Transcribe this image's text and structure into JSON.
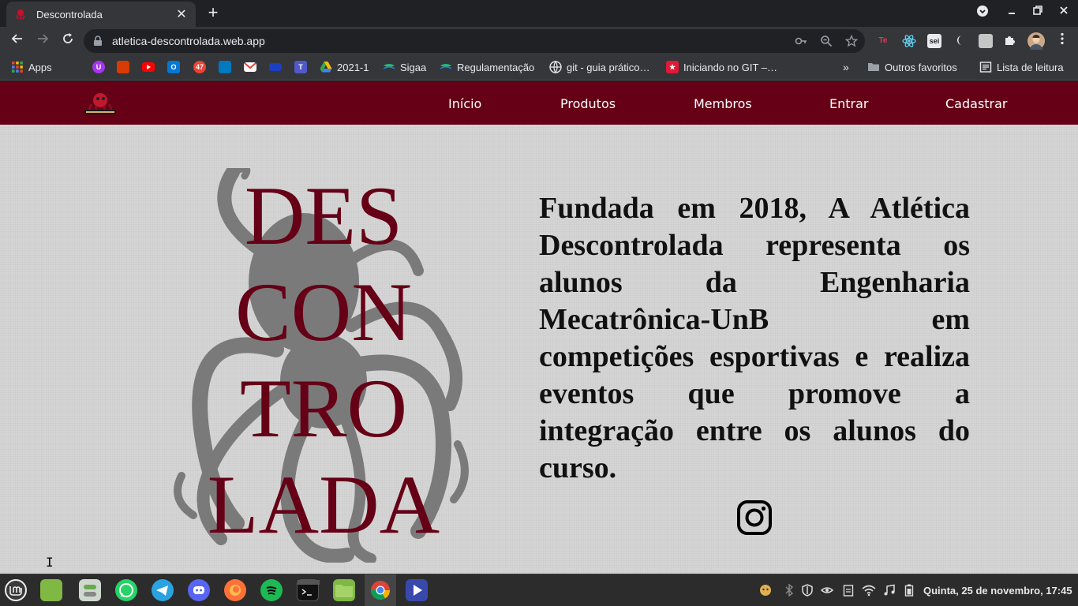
{
  "browser": {
    "tab_title": "Descontrolada",
    "url": "atletica-descontrolada.web.app",
    "new_tab": "+",
    "tab_close": "✕"
  },
  "bookmarks": {
    "apps": "Apps",
    "b_2021": "2021-1",
    "sigaa": "Sigaa",
    "regulamentacao": "Regulamentação",
    "git_guia": "git - guia prático…",
    "iniciando_git": "Iniciando no GIT –…",
    "overflow": "»",
    "outros": "Outros favoritos",
    "leitura": "Lista de leitura"
  },
  "extensions": {
    "te": "Te",
    "sei": "sei"
  },
  "site": {
    "nav": [
      "Início",
      "Produtos",
      "Membros",
      "Entrar",
      "Cadastrar"
    ],
    "hero_words": [
      "DES",
      "CON",
      "TRO",
      "LADA"
    ],
    "about": "Fundada em 2018, A Atlética Descontrolada representa os alunos da Engenharia Mecatrônica-UnB em competições esportivas e realiza eventos que promove a integração entre os alunos do curso."
  },
  "taskbar": {
    "clock": "Quinta, 25 de novembro, 17:45"
  },
  "colors": {
    "brand": "#650016",
    "page_bg": "#d5d5d5",
    "octopus": "#7a7a7a"
  }
}
